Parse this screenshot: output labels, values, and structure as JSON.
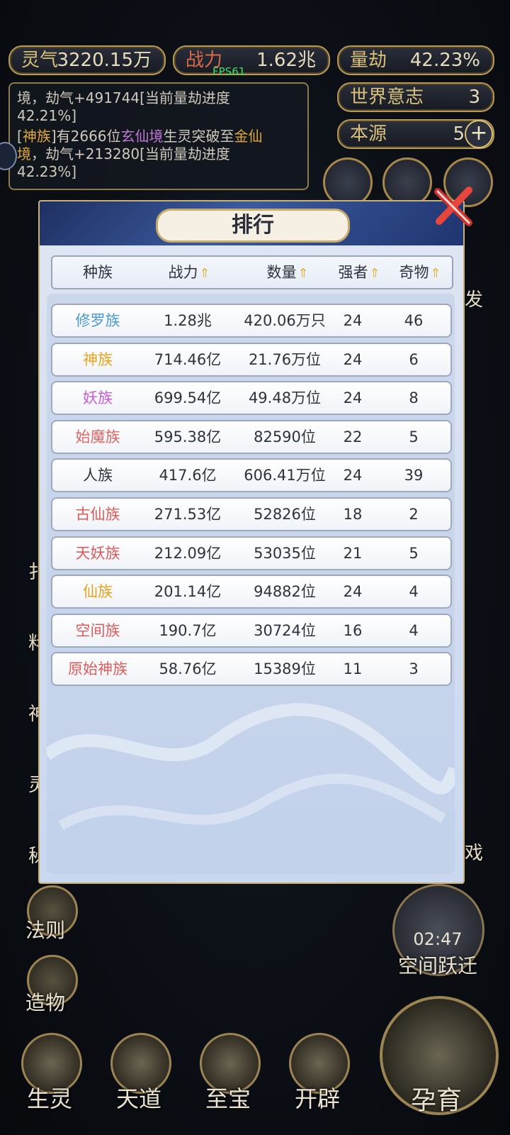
{
  "resources": {
    "lingqi": {
      "label": "灵气",
      "value": "3220.15万"
    },
    "zhanli": {
      "label": "战力",
      "value": "1.62兆"
    },
    "liangjie": {
      "label": "量劫",
      "value": "42.23%"
    },
    "shijie": {
      "label": "世界意志",
      "value": "3"
    },
    "benyuan": {
      "label": "本源",
      "value": "5"
    }
  },
  "fps": "FPS61",
  "log": {
    "line1a": "境，劫气+491744[当前量劫进度",
    "line1b": "42.21%]",
    "line2_pre": "[",
    "line2_race": "神族",
    "line2_mid": "]有2666位",
    "line2_realm": "玄仙境",
    "line2_mid2": "生灵突破至",
    "line2_target": "金仙",
    "line3_target": "境",
    "line3_rest": "，劫气+213280[当前量劫进度",
    "line4": "42.23%]"
  },
  "side_left": [
    "扌",
    "料",
    "神",
    "灵",
    "秘"
  ],
  "side_right": [
    "发",
    "戏"
  ],
  "side_bottom_left": [
    {
      "label": "法则"
    },
    {
      "label": "造物"
    }
  ],
  "space_jump": {
    "timer": "02:47",
    "label": "空间跃迁"
  },
  "panel": {
    "title": "排行",
    "headers": {
      "race": "种族",
      "power": "战力",
      "count": "数量",
      "strong": "强者",
      "treasure": "奇物"
    },
    "sort_arrow": "⇑",
    "rows": [
      {
        "race": "修罗族",
        "power": "1.28兆",
        "count": "420.06万只",
        "strong": "24",
        "treasure": "46",
        "color": "#4a9ad8"
      },
      {
        "race": "神族",
        "power": "714.46亿",
        "count": "21.76万位",
        "strong": "24",
        "treasure": "6",
        "color": "#e8a21c"
      },
      {
        "race": "妖族",
        "power": "699.54亿",
        "count": "49.48万位",
        "strong": "24",
        "treasure": "8",
        "color": "#c65cd6"
      },
      {
        "race": "始魔族",
        "power": "595.38亿",
        "count": "82590位",
        "strong": "22",
        "treasure": "5",
        "color": "#e06464"
      },
      {
        "race": "人族",
        "power": "417.6亿",
        "count": "606.41万位",
        "strong": "24",
        "treasure": "39",
        "color": "#2e323c"
      },
      {
        "race": "古仙族",
        "power": "271.53亿",
        "count": "52826位",
        "strong": "18",
        "treasure": "2",
        "color": "#e05a5a"
      },
      {
        "race": "天妖族",
        "power": "212.09亿",
        "count": "53035位",
        "strong": "21",
        "treasure": "5",
        "color": "#e05a5a"
      },
      {
        "race": "仙族",
        "power": "201.14亿",
        "count": "94882位",
        "strong": "24",
        "treasure": "4",
        "color": "#e8a21c"
      },
      {
        "race": "空间族",
        "power": "190.7亿",
        "count": "30724位",
        "strong": "16",
        "treasure": "4",
        "color": "#e05a5a"
      },
      {
        "race": "原始神族",
        "power": "58.76亿",
        "count": "15389位",
        "strong": "11",
        "treasure": "3",
        "color": "#e05a5a"
      }
    ]
  },
  "nav": [
    {
      "label": "生灵"
    },
    {
      "label": "天道"
    },
    {
      "label": "至宝"
    },
    {
      "label": "开辟"
    },
    {
      "label": "孕育"
    }
  ]
}
